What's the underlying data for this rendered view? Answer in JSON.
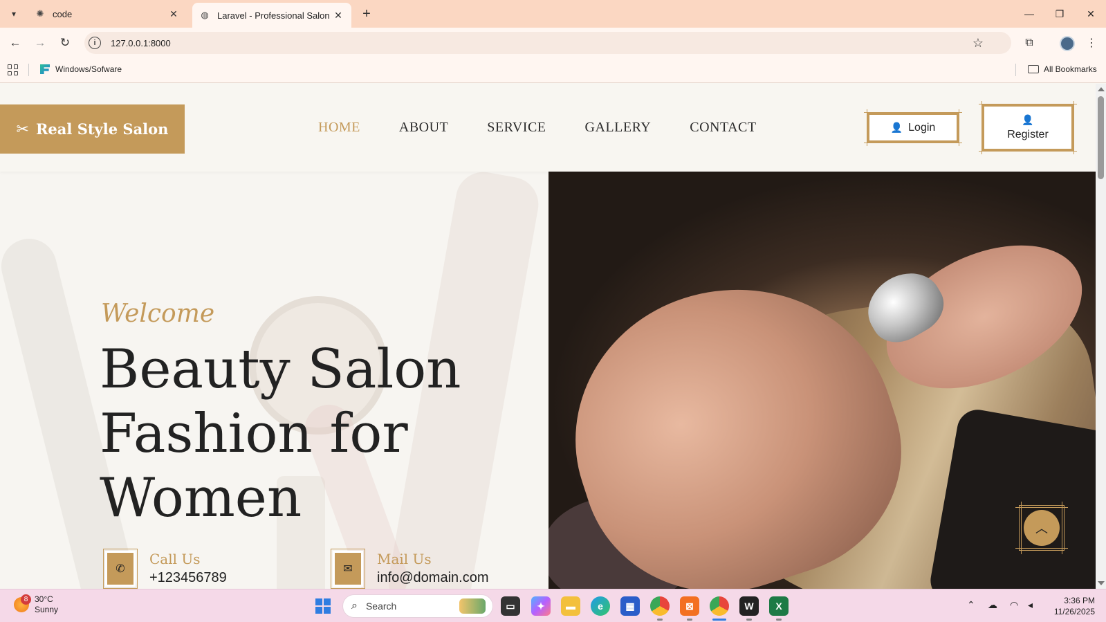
{
  "browser": {
    "tabs": [
      {
        "title": "code",
        "icon": "openai-icon",
        "active": false
      },
      {
        "title": "Laravel - Professional Salon Ma",
        "icon": "globe-icon",
        "active": true
      }
    ],
    "url": "127.0.0.1:8000",
    "bookmarks": [
      {
        "label": "Windows/Sofware"
      }
    ],
    "all_bookmarks_label": "All Bookmarks"
  },
  "site": {
    "brand": "Real Style Salon",
    "nav": [
      {
        "label": "HOME",
        "active": true
      },
      {
        "label": "ABOUT",
        "active": false
      },
      {
        "label": "SERVICE",
        "active": false
      },
      {
        "label": "GALLERY",
        "active": false
      },
      {
        "label": "CONTACT",
        "active": false
      }
    ],
    "login_label": "Login",
    "register_label": "Register",
    "accent_color": "#c49a5a"
  },
  "hero": {
    "welcome": "Welcome",
    "headline_lines": [
      "Beauty Salon",
      "Fashion for",
      "Women"
    ],
    "call_label": "Call Us",
    "call_value": "+123456789",
    "mail_label": "Mail Us",
    "mail_value": "info@domain.com"
  },
  "taskbar": {
    "weather_temp": "30°C",
    "weather_desc": "Sunny",
    "weather_badge": "8",
    "search_placeholder": "Search",
    "time": "3:36 PM",
    "date": "11/26/2025"
  }
}
